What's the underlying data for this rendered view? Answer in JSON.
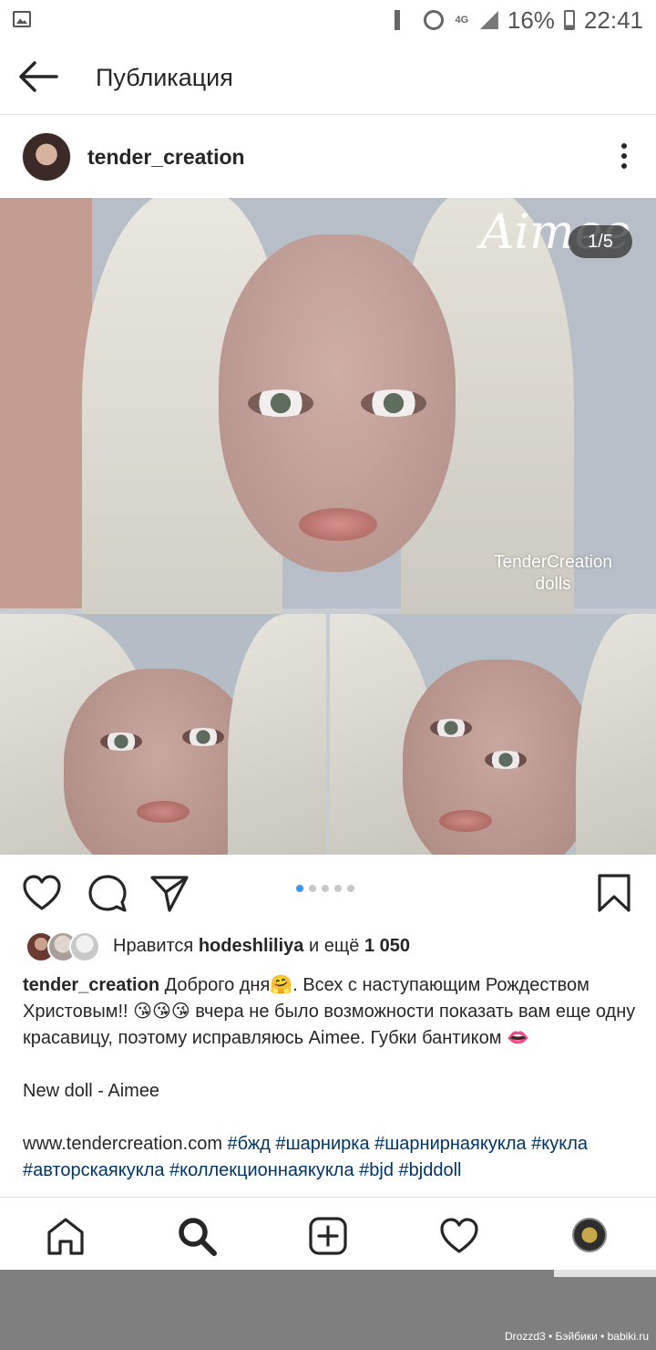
{
  "status_bar": {
    "battery": "16%",
    "time": "22:41",
    "network": "4G"
  },
  "topbar": {
    "title": "Публикация"
  },
  "post": {
    "author": "tender_creation",
    "photo_counter": "1/5",
    "photo_text_script": "Aimee",
    "photo_text_brand_line1": "TenderCreation",
    "photo_text_brand_line2": "dolls",
    "carousel_total": 5,
    "carousel_active": 1
  },
  "likes": {
    "prefix": "Нравится",
    "user": "hodeshliliya",
    "middle": "и ещё",
    "count": "1 050"
  },
  "caption": {
    "user": "tender_creation",
    "line1": "Доброго дня🤗. Всех с наступающим Рождеством Христовым!! 😘😘😘 вчера не было возможности показать вам еще одну красавицу, поэтому исправляюсь Aimee. Губки бантиком 👄",
    "line2": "New doll - Aimee",
    "site": "www.tendercreation.com",
    "hashtags": "#бжд  #шарнирка #шарнирнаякукла #кукла #авторскаякукла #коллекционнаякукла #bjd #bjddoll"
  },
  "watermark": "Drozzd3 • Бэйбики • babiki.ru"
}
